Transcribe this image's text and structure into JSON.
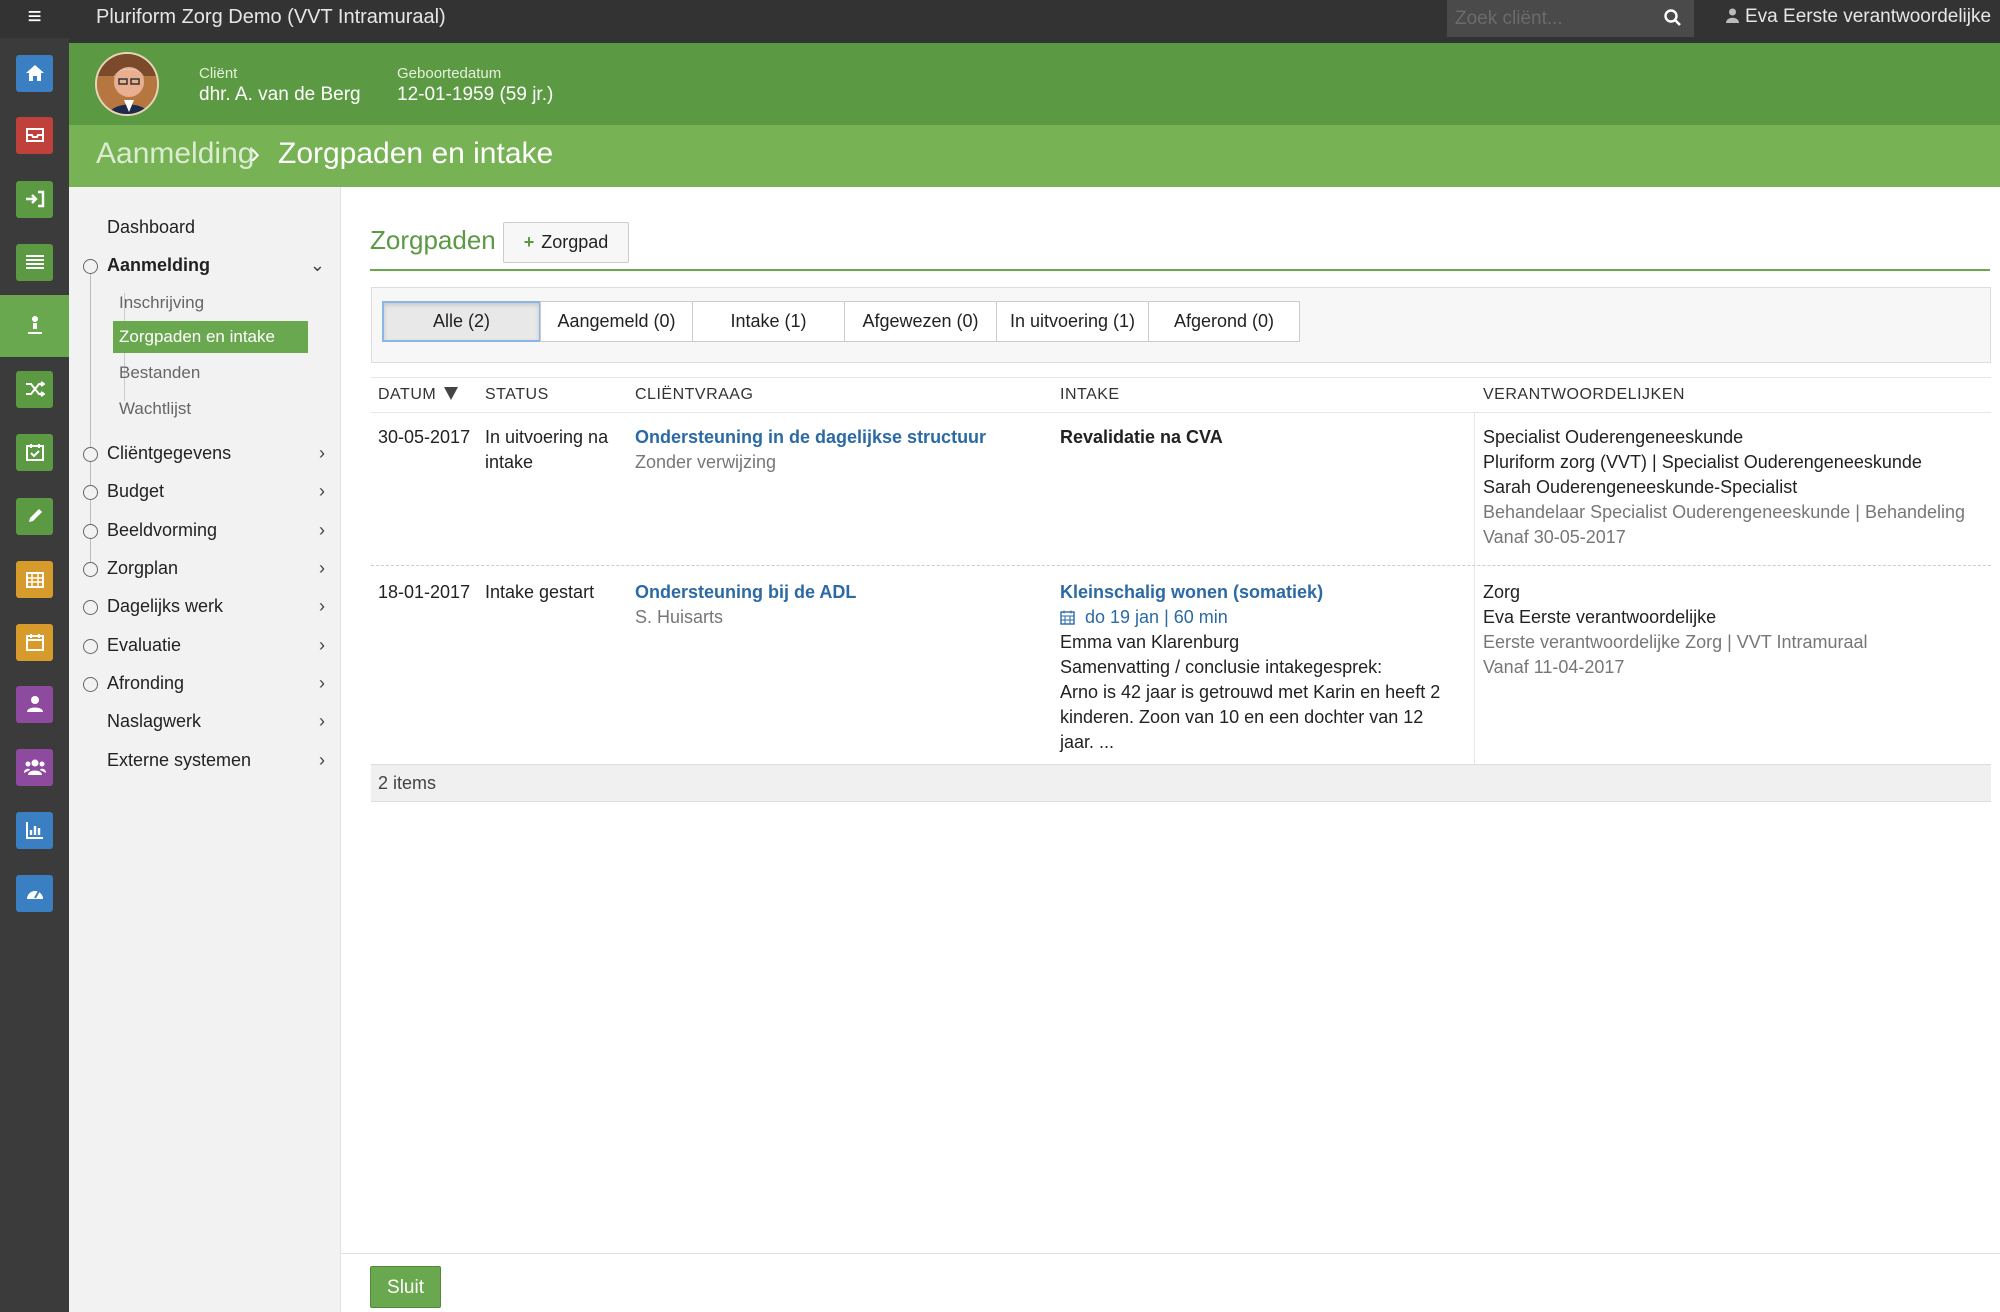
{
  "app": {
    "title": "Pluriform Zorg Demo  (VVT Intramuraal)"
  },
  "menu_icon": "hamburger-icon",
  "search": {
    "placeholder": "Zoek cliënt..."
  },
  "user": {
    "name": "Eva Eerste verantwoordelijke"
  },
  "rail": [
    {
      "icon": "home-icon",
      "color": "#3a7fc1"
    },
    {
      "icon": "inbox-icon",
      "color": "#c0413b"
    },
    {
      "icon": "sign-in-icon",
      "color": "#5b9a43"
    },
    {
      "icon": "list-icon",
      "color": "#5b9a43"
    },
    {
      "icon": "person-marker-icon",
      "color": "#6aa84f",
      "active": true
    },
    {
      "icon": "shuffle-icon",
      "color": "#5b9a43"
    },
    {
      "icon": "calendar-check-icon",
      "color": "#5b9a43"
    },
    {
      "icon": "pencil-icon",
      "color": "#5b9a43"
    },
    {
      "icon": "calendar-grid-icon",
      "color": "#d79b2b"
    },
    {
      "icon": "calendar-icon",
      "color": "#d79b2b"
    },
    {
      "icon": "user-icon",
      "color": "#8e4a9e"
    },
    {
      "icon": "users-icon",
      "color": "#8e4a9e"
    },
    {
      "icon": "bar-chart-icon",
      "color": "#3a7fc1"
    },
    {
      "icon": "dashboard-gauge-icon",
      "color": "#3a7fc1"
    }
  ],
  "client": {
    "client_label": "Cliënt",
    "client_name": "dhr. A. van de Berg",
    "dob_label": "Geboortedatum",
    "dob_value": "12-01-1959 (59 jr.)"
  },
  "breadcrumb": {
    "parent": "Aanmelding",
    "separator": "›",
    "current": "Zorgpaden en intake"
  },
  "sidebar": {
    "dashboard": "Dashboard",
    "aanmelding": "Aanmelding",
    "sub": [
      "Inschrijving",
      "Zorgpaden en intake",
      "Bestanden",
      "Wachtlijst"
    ],
    "items": [
      "Cliëntgegevens",
      "Budget",
      "Beeldvorming",
      "Zorgplan",
      "Dagelijks werk",
      "Evaluatie",
      "Afronding"
    ],
    "extra": [
      "Naslagwerk",
      "Externe systemen"
    ]
  },
  "main": {
    "title": "Zorgpaden",
    "add_button": "Zorgpad",
    "filters": [
      "Alle (2)",
      "Aangemeld (0)",
      "Intake (1)",
      "Afgewezen (0)",
      "In uitvoering (1)",
      "Afgerond (0)"
    ],
    "columns": [
      "DATUM",
      "STATUS",
      "CLIËNTVRAAG",
      "INTAKE",
      "VERANTWOORDELIJKEN"
    ],
    "rows": [
      {
        "datum": "30-05-2017",
        "status_1": "In uitvoering na",
        "status_2": "intake",
        "vraag_title": "Ondersteuning in de dagelijkse structuur",
        "vraag_sub": "Zonder verwijzing",
        "intake_title": "Revalidatie na CVA",
        "resp": [
          "Specialist Ouderengeneeskunde",
          "Pluriform zorg (VVT) | Specialist Ouderengeneeskunde",
          "Sarah Ouderengeneeskunde-Specialist"
        ],
        "resp_muted": [
          "Behandelaar Specialist Ouderengeneeskunde | Behandeling",
          "Vanaf 30-05-2017"
        ]
      },
      {
        "datum": "18-01-2017",
        "status_1": "Intake gestart",
        "vraag_title": "Ondersteuning bij de ADL",
        "vraag_sub": "S. Huisarts",
        "intake_title": "Kleinschalig wonen (somatiek)",
        "intake_date": "do 19 jan | 60 min",
        "intake_lines": [
          "Emma van Klarenburg",
          "Samenvatting / conclusie intakegesprek:",
          "Arno is 42 jaar is getrouwd met Karin en heeft 2",
          "kinderen. Zoon van 10 en een dochter van 12",
          "jaar. ..."
        ],
        "resp": [
          "Zorg",
          "Eva Eerste verantwoordelijke"
        ],
        "resp_muted": [
          "Eerste verantwoordelijke Zorg | VVT Intramuraal",
          "Vanaf 11-04-2017"
        ]
      }
    ],
    "footer": "2 items",
    "close_button": "Sluit"
  }
}
